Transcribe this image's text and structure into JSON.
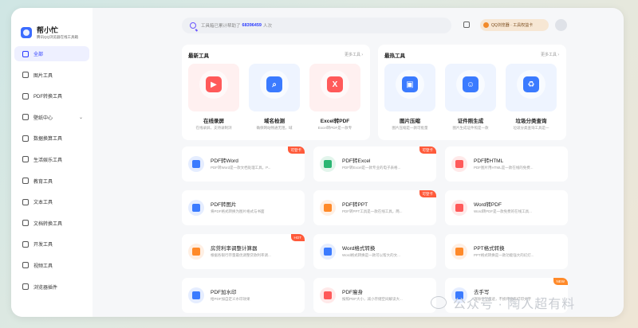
{
  "brand": {
    "title": "帮小忙",
    "subtitle": "腾讯QQ浏览器在线工具箱"
  },
  "sidebar": {
    "items": [
      {
        "label": "全部",
        "icon": "grid-icon"
      },
      {
        "label": "图片工具",
        "icon": "image-icon"
      },
      {
        "label": "PDF转换工具",
        "icon": "pdf-icon"
      },
      {
        "label": "壁纸中心",
        "icon": "wallpaper-icon"
      },
      {
        "label": "数据换算工具",
        "icon": "calculator-icon"
      },
      {
        "label": "生活娱乐工具",
        "icon": "life-icon"
      },
      {
        "label": "教育工具",
        "icon": "education-icon"
      },
      {
        "label": "文本工具",
        "icon": "text-icon"
      },
      {
        "label": "文档转换工具",
        "icon": "document-icon"
      },
      {
        "label": "开发工具",
        "icon": "code-icon"
      },
      {
        "label": "视频工具",
        "icon": "video-icon"
      },
      {
        "label": "浏览器插件",
        "icon": "plugin-icon"
      }
    ]
  },
  "search": {
    "prefix": "工具箱已累计帮助了",
    "count": "68396459",
    "suffix": "人次"
  },
  "qq": {
    "label": "QQ浏览器 · 工具权益卡"
  },
  "latest": {
    "title": "最新工具",
    "more": "更多工具 ›",
    "tiles": [
      {
        "name": "在线录屏",
        "desc": "在线录屏，支持录制浏",
        "color": "#ff5a5a",
        "bg": "#fff0f0",
        "glyph": "▶"
      },
      {
        "name": "域名检测",
        "desc": "确保网站畅通无阻，域",
        "color": "#3b7bff",
        "bg": "#eef4ff",
        "glyph": "⌕"
      },
      {
        "name": "Excel转PDF",
        "desc": "Excel转PDF是一款专",
        "color": "#ff5a5a",
        "bg": "#fff0f0",
        "glyph": "X"
      }
    ]
  },
  "hot": {
    "title": "最热工具",
    "more": "更多工具 ›",
    "tiles": [
      {
        "name": "图片压缩",
        "desc": "图片压缩是一款可批量",
        "color": "#3b7bff",
        "bg": "#eef4ff",
        "glyph": "▣"
      },
      {
        "name": "证件照生成",
        "desc": "图片生成证件照是一款",
        "color": "#3b7bff",
        "bg": "#eef4ff",
        "glyph": "☺"
      },
      {
        "name": "垃圾分类查询",
        "desc": "垃圾分类查询工具是一",
        "color": "#3b7bff",
        "bg": "#eef4ff",
        "glyph": "♻"
      }
    ]
  },
  "cards": [
    {
      "name": "PDF转Word",
      "desc": "PDF转Word是一款文档处理工具，P...",
      "color": "#3b7bff",
      "badge": "可登卡",
      "badge_color": "#ff5a3a"
    },
    {
      "name": "PDF转Excel",
      "desc": "PDF转Excel是一款专业的电子表格...",
      "color": "#2bb673",
      "badge": "可登卡",
      "badge_color": "#ff5a3a"
    },
    {
      "name": "PDF转HTML",
      "desc": "PDF图片用HTML是一款在线的免费...",
      "color": "#ff5a5a",
      "badge": "",
      "badge_color": ""
    },
    {
      "name": "PDF转图片",
      "desc": "将PDF格式转换为图片格式与书面",
      "color": "#3b7bff",
      "badge": "",
      "badge_color": ""
    },
    {
      "name": "PDF转PPT",
      "desc": "PDF转PPT工具是一款在线工具。两...",
      "color": "#ff8a2a",
      "badge": "可登卡",
      "badge_color": "#ff5a3a"
    },
    {
      "name": "Word转PDF",
      "desc": "Word转PDF是一款免费的在线工具...",
      "color": "#ff5a5a",
      "badge": "",
      "badge_color": ""
    },
    {
      "name": "房贷利率调整计算器",
      "desc": "根据各银行存量最优调整贷款利率调...",
      "color": "#ff8a2a",
      "badge": "HOT",
      "badge_color": "#ff5a3a"
    },
    {
      "name": "Word格式转换",
      "desc": "Word格式转换是一款可以帮大的文...",
      "color": "#3b7bff",
      "badge": "",
      "badge_color": ""
    },
    {
      "name": "PPT格式转换",
      "desc": "PPT格式转换是一款功能强大的幻灯...",
      "color": "#ff8a2a",
      "badge": "",
      "badge_color": ""
    },
    {
      "name": "PDF加水印",
      "desc": "给PDF加自定义水印效果",
      "color": "#3b7bff",
      "badge": "",
      "badge_color": ""
    },
    {
      "name": "PDF瘦身",
      "desc": "按照PDF大小，减小存储空间解读大...",
      "color": "#ff5a5a",
      "badge": "",
      "badge_color": ""
    },
    {
      "name": "去手写",
      "desc": "消除手写痕迹，不损坏原有打印文字",
      "color": "#3b7bff",
      "badge": "NEW",
      "badge_color": "#ff8a2a"
    }
  ],
  "watermark": {
    "text": "公众号 · 陶人超有料"
  }
}
